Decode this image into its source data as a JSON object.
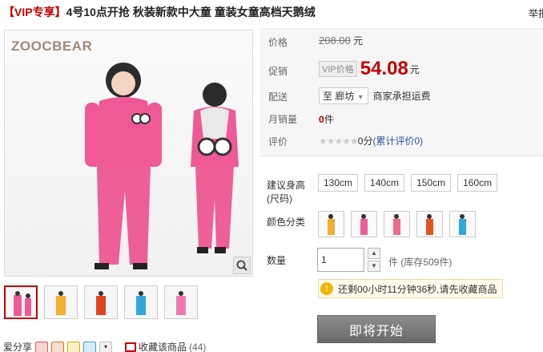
{
  "title": {
    "tag": "【VIP专享】",
    "text": "4号10点开抢 秋装新款中大童 童装女童高档天鹅绒"
  },
  "report_link": "举报",
  "gallery": {
    "logo": "ZOOCBEAR",
    "thumb_count": 5
  },
  "share": {
    "label": "爱分享",
    "fav_label": "收藏该商品",
    "fav_count": "(44)"
  },
  "info": {
    "price_label": "价格",
    "original_price": "208.00",
    "original_unit": "元",
    "promo_label": "促销",
    "vip_badge": "VIP价格",
    "promo_price": "54.08",
    "promo_unit": "元",
    "delivery_label": "配送",
    "delivery_city": "至 廊坊",
    "delivery_note": "商家承担运费",
    "sales_label": "月销量",
    "sales_count": "0",
    "sales_unit": "件",
    "rating_label": "评价",
    "rating_stars": "★★★★★",
    "rating_score": "0分",
    "rating_link": "(累计评价0)"
  },
  "options": {
    "size_label_1": "建议身高",
    "size_label_2": "(尺码)",
    "sizes": [
      "130cm",
      "140cm",
      "150cm",
      "160cm"
    ],
    "color_label": "颜色分类",
    "quantity_label": "数量",
    "quantity_value": "1",
    "quantity_unit": "件 (库存509件)",
    "notice": "还剩00小时11分钟36秒,请先收藏商品",
    "buy_button": "即将开始"
  },
  "colors": {
    "accent": "#c40000",
    "link": "#2953a6",
    "button": "#7a7a7a"
  },
  "icons": [
    "zoom-icon",
    "weibo-icon",
    "renren-icon",
    "kaixin-icon",
    "qzone-icon",
    "more-share-icon",
    "favorite-icon",
    "bulb-icon",
    "chevron-down-icon"
  ]
}
